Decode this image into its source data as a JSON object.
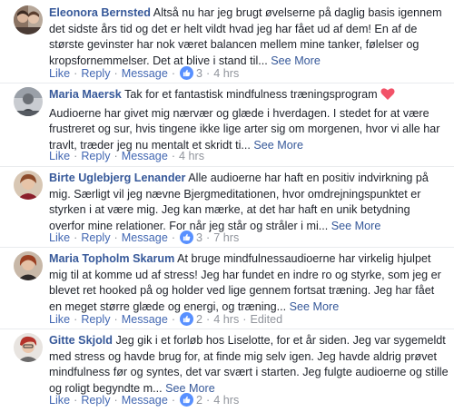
{
  "actions": {
    "like": "Like",
    "reply": "Reply",
    "message": "Message",
    "separator": "·",
    "see_more": "See More"
  },
  "colors": {
    "link": "#365899",
    "action": "#4267b2",
    "meta": "#90949c",
    "like_badge": "#5890ff",
    "heart": "#f25268"
  },
  "comments": [
    {
      "author": "Eleonora Bernsted",
      "text": "Altså nu har jeg brugt øvelserne på daglig basis igennem det sidste års tid og det er helt vildt hvad jeg har fået ud af dem! En af de største gevinster har nok været balancen mellem mine tanker, følelser og kropsfornemmelser. Det at blive i stand til...",
      "likes": "3",
      "time": "4 hrs",
      "edited": ""
    },
    {
      "author": "Maria Maersk",
      "text": "Tak for et fantastisk mindfulness træningsprogram",
      "text_after_emoji": "Audioerne har givet mig nærvær og glæde i hverdagen. I stedet for at være frustreret og sur, hvis tingene ikke lige arter sig om morgenen, hvor vi alle har travlt, træder jeg nu mentalt et skridt ti...",
      "emoji": "heart-emoji",
      "likes": "",
      "time": "4 hrs",
      "edited": ""
    },
    {
      "author": "Birte Uglebjerg Lenander",
      "text": "Alle audioerne har haft en positiv indvirkning på mig. Særligt vil jeg nævne Bjergmeditationen, hvor omdrejningspunktet er styrken i at være mig. Jeg kan mærke, at det har haft en unik betydning overfor mine relationer. For når jeg står og stråler i mi...",
      "likes": "3",
      "time": "7 hrs",
      "edited": ""
    },
    {
      "author": "Maria Topholm Skarum",
      "text": "At bruge mindfulnessaudioerne har virkelig hjulpet mig til at komme ud af stress! Jeg har fundet en indre ro og styrke, som jeg er blevet ret hooked på og holder ved lige gennem fortsat træning. Jeg har fået en meget større glæde og energi, og træning...",
      "likes": "2",
      "time": "4 hrs",
      "edited": "Edited"
    },
    {
      "author": "Gitte Skjold",
      "text": "Jeg gik i et forløb hos Liselotte, for et år siden. Jeg var sygemeldt med stress og havde brug for, at finde mig selv igen. Jeg havde aldrig prøvet mindfulness før og syntes, det var svært i starten. Jeg fulgte audioerne og stille og roligt begyndte m...",
      "likes": "2",
      "time": "4 hrs",
      "edited": ""
    }
  ]
}
